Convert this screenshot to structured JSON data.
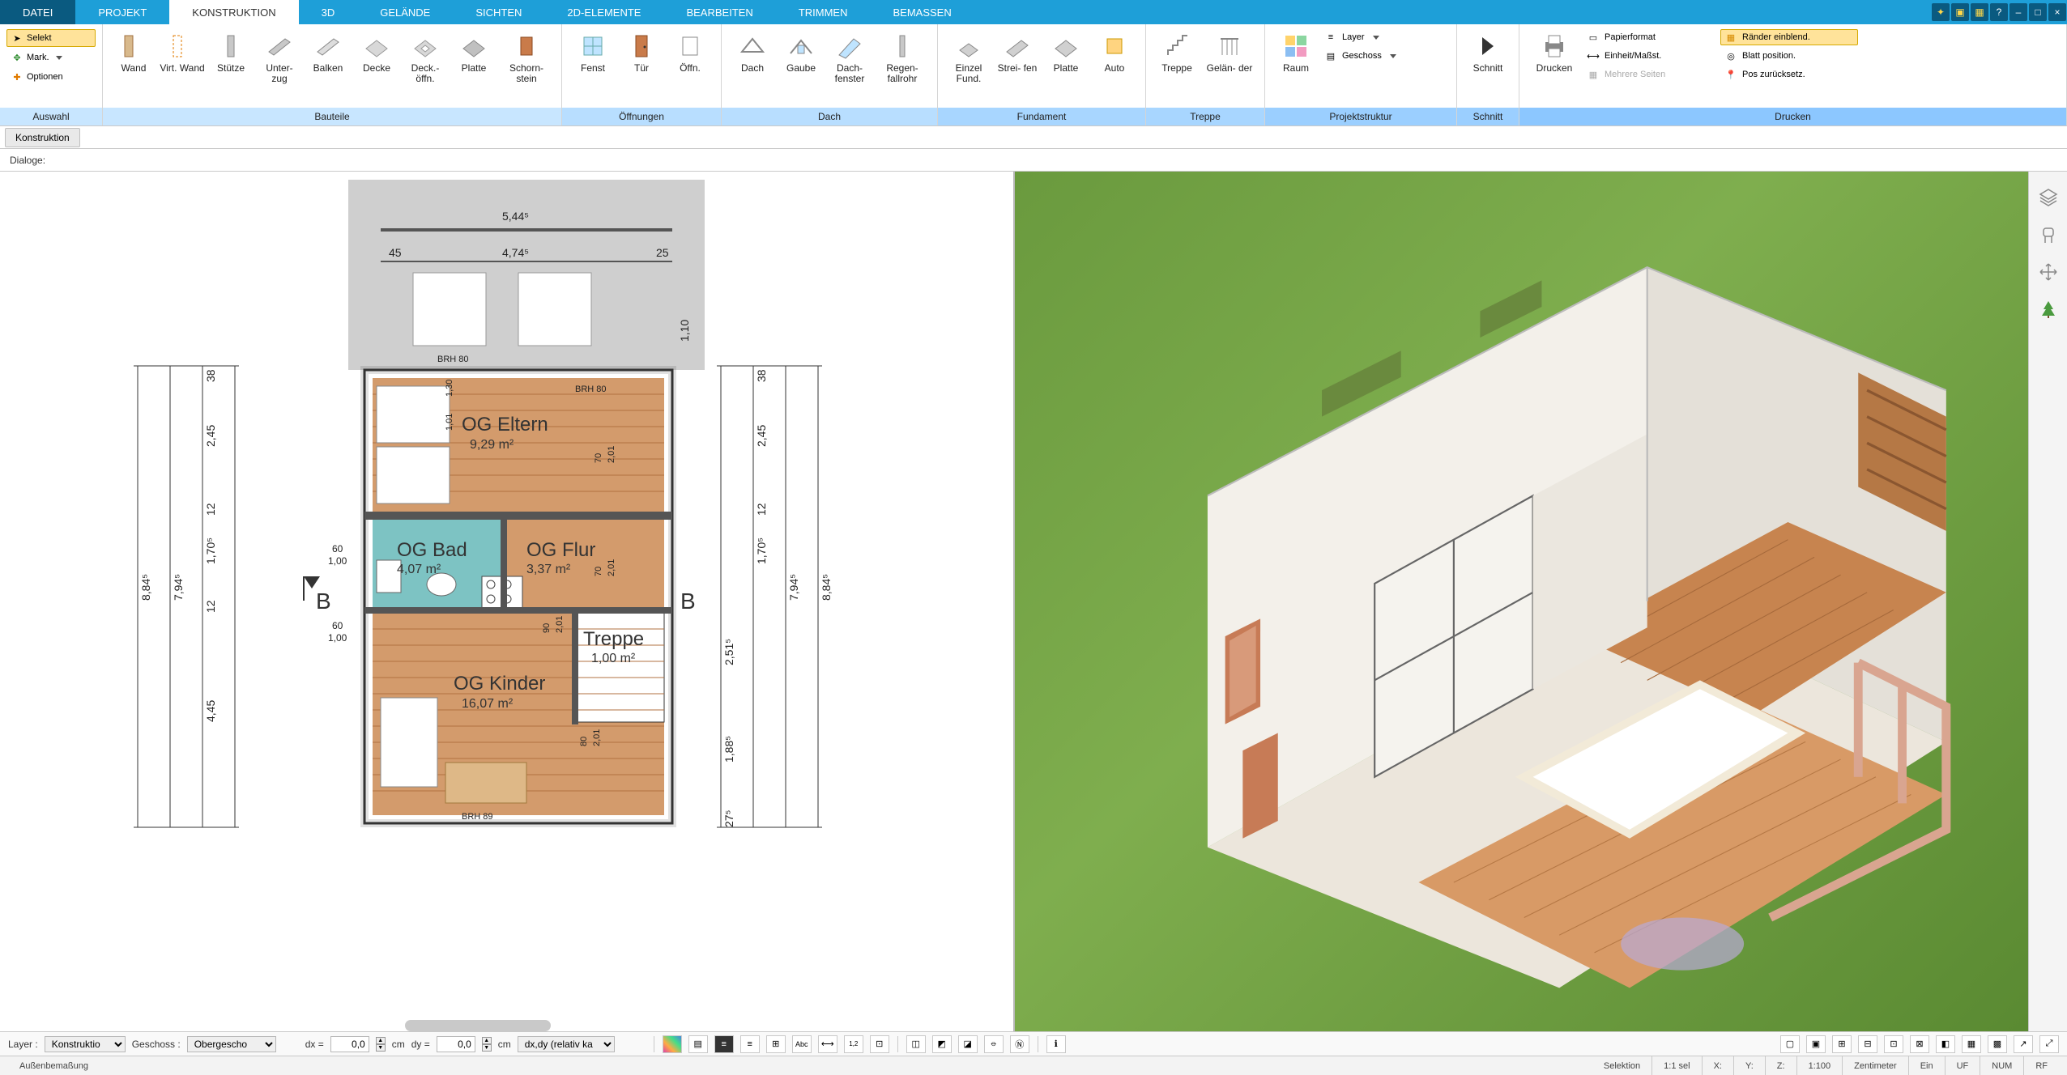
{
  "menu": {
    "tabs": [
      "DATEI",
      "PROJEKT",
      "KONSTRUKTION",
      "3D",
      "GELÄNDE",
      "SICHTEN",
      "2D-ELEMENTE",
      "BEARBEITEN",
      "TRIMMEN",
      "BEMASSEN"
    ],
    "active_index": 2
  },
  "ribbon": {
    "auswahl": {
      "label": "Auswahl",
      "selekt": "Selekt",
      "mark": "Mark.",
      "optionen": "Optionen"
    },
    "bauteile": {
      "label": "Bauteile",
      "items": [
        "Wand",
        "Virt. Wand",
        "Stütze",
        "Unter- zug",
        "Balken",
        "Decke",
        "Deck.- öffn.",
        "Platte",
        "Schorn- stein"
      ]
    },
    "oeffnungen": {
      "label": "Öffnungen",
      "items": [
        "Fenst",
        "Tür",
        "Öffn."
      ]
    },
    "dach": {
      "label": "Dach",
      "items": [
        "Dach",
        "Gaube",
        "Dach- fenster",
        "Regen- fallrohr"
      ]
    },
    "fundament": {
      "label": "Fundament",
      "items": [
        "Einzel Fund.",
        "Strei- fen",
        "Platte",
        "Auto"
      ]
    },
    "treppe": {
      "label": "Treppe",
      "items": [
        "Treppe",
        "Gelän- der"
      ]
    },
    "projektstruktur": {
      "label": "Projektstruktur",
      "raum": "Raum",
      "layer": "Layer",
      "geschoss": "Geschoss"
    },
    "schnitt": {
      "label": "Schnitt",
      "item": "Schnitt"
    },
    "drucken": {
      "label": "Drucken",
      "item": "Drucken",
      "papierformat": "Papierformat",
      "einheit": "Einheit/Maßst.",
      "mehrere": "Mehrere Seiten",
      "raender": "Ränder einblend.",
      "blattpos": "Blatt position.",
      "posrueck": "Pos zurücksetz."
    }
  },
  "subbars": {
    "konstruktion": "Konstruktion",
    "dialoge": "Dialoge:"
  },
  "plan": {
    "dims_top": {
      "d1": "5,44⁵",
      "d2": "4,74⁵",
      "d3": "45",
      "d4": "25"
    },
    "dims_left": {
      "d1": "38",
      "d2": "2,45",
      "d3": "12",
      "d4": "1,70⁵",
      "d5": "12",
      "d6": "4,45",
      "d7": "8,84⁵",
      "d8": "7,94⁵",
      "d9": "60",
      "d10": "1,00"
    },
    "dims_right": {
      "d1": "38",
      "d2": "2,45",
      "d3": "12",
      "d4": "1,70⁵",
      "d5": "2,51⁵",
      "d6": "1,88⁵",
      "d7": "8,84⁵",
      "d8": "7,94⁵",
      "d9": "27⁵",
      "d10": "1,10"
    },
    "dims_inner": {
      "a": "1,30",
      "b": "1,01",
      "c": "70",
      "d": "2,01",
      "e": "70",
      "f": "2,01",
      "g": "90",
      "h": "2,01",
      "i": "80",
      "j": "2,01"
    },
    "brh": "BRH 80",
    "brh2": "BRH 89",
    "section": "B",
    "rooms": {
      "eltern": {
        "name": "OG Eltern",
        "area": "9,29 m²"
      },
      "bad": {
        "name": "OG Bad",
        "area": "4,07 m²"
      },
      "flur": {
        "name": "OG Flur",
        "area": "3,37 m²"
      },
      "treppe": {
        "name": "Treppe",
        "area": "1,00 m²"
      },
      "kinder": {
        "name": "OG Kinder",
        "area": "16,07 m²"
      }
    }
  },
  "bottom": {
    "layer_label": "Layer :",
    "layer_value": "Konstruktio",
    "geschoss_label": "Geschoss :",
    "geschoss_value": "Obergescho",
    "dx_label": "dx =",
    "dx_value": "0,0",
    "dy_label": "dy =",
    "dy_value": "0,0",
    "unit": "cm",
    "mode": "dx,dy (relativ ka"
  },
  "status": {
    "left": "Außenbemaßung",
    "selektion": "Selektion",
    "ratio": "1:1 sel",
    "x": "X:",
    "y": "Y:",
    "z": "Z:",
    "scale": "1:100",
    "unit": "Zentimeter",
    "ein": "Ein",
    "uf": "UF",
    "num": "NUM",
    "rf": "RF"
  }
}
